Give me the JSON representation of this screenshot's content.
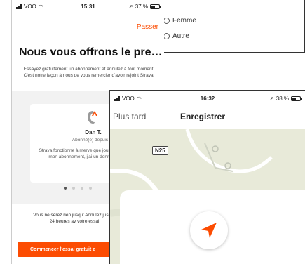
{
  "gender_panel": {
    "options": [
      {
        "label": "Femme"
      },
      {
        "label": "Autre"
      }
    ]
  },
  "screen_one": {
    "status": {
      "carrier": "VOO",
      "time": "15:31",
      "battery": "37 %"
    },
    "skip_label": "Passer",
    "title": "Nous vous offrons le pre…",
    "intro": "Essayez gratuitement un abonnement et annulez à tout moment. C'est notre façon à nous de vous remercier d'avoir rejoint Strava.",
    "testimonial": {
      "name": "Dan T.",
      "subtitle": "Abonné(e) depuis 20",
      "quote": "Strava fonctionne à merve que journal d'entraînement mon abonnement, j'ai un données à analyse"
    },
    "carousel": {
      "count": 4,
      "active": 0
    },
    "footnote": "Vous ne serez rien jusqu' Annulez jusqu'à 24 heures av votre essai.",
    "cta_label": "Commencer l'essai gratuit e"
  },
  "screen_two": {
    "status": {
      "carrier": "VOO",
      "time": "16:32",
      "battery": "38 %"
    },
    "later_label": "Plus tard",
    "title": "Enregistrer",
    "road_label": "N25",
    "accent": "#fc4c02"
  }
}
